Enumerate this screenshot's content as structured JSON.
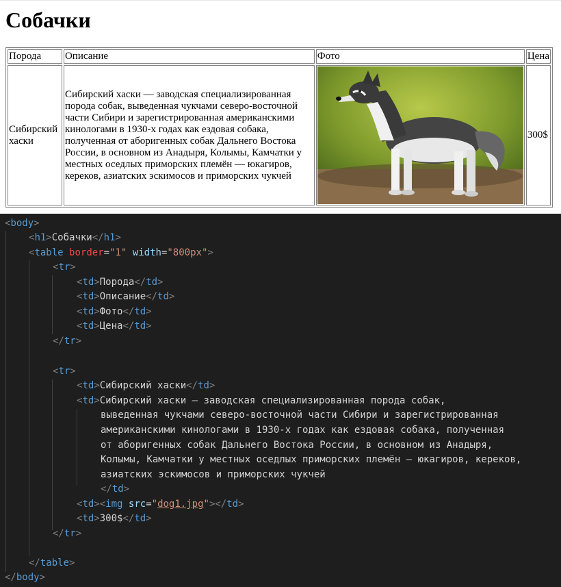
{
  "page": {
    "heading": "Собачки",
    "table": {
      "headers": [
        "Порода",
        "Описание",
        "Фото",
        "Цена"
      ],
      "row": {
        "breed": "Сибирский хаски",
        "description": "Сибирский хаски — заводская специализированная порода собак, выведенная чукчами северо-восточной части Сибири и зарегистрированная американскими кинологами в 1930-х годах как ездовая собака, полученная от аборигенных собак Дальнего Востока России, в основном из Анадыря, Колымы, Камчатки у местных оседлых приморских племён — юкагиров, кереков, азиатских эскимосов и приморских чукчей",
        "photo_icon": "siberian-husky-photo",
        "price": "300$"
      }
    }
  },
  "code": {
    "body_open": "body",
    "h1_tag": "h1",
    "h1_text": "Собачки",
    "table_tag": "table",
    "attr_border": "border",
    "attr_border_val": "\"1\"",
    "attr_width": "width",
    "attr_width_val": "\"800px\"",
    "tr": "tr",
    "td": "td",
    "cells_row1": [
      "Порода",
      "Описание",
      "Фото",
      "Цена"
    ],
    "cell_breed": "Сибирский хаски",
    "desc_lines": [
      "Сибирский хаски — заводская специализированная порода собак,",
      "выведенная чукчами северо-восточной части Сибири и зарегистрированная",
      "американскими кинологами в 1930-х годах как ездовая собака, полученная",
      "от аборигенных собак Дальнего Востока России, в основном из Анадыря,",
      "Колымы, Камчатки у местных оседлых приморских племён — юкагиров, кереков,",
      "азиатских эскимосов и приморских чукчей"
    ],
    "img_tag": "img",
    "attr_src": "src",
    "src_val": "dog1.jpg",
    "price": "300$"
  },
  "colors": {
    "editor_bg": "#1e1e1e",
    "tag": "#569cd6",
    "attr_name": "#9cdcfe",
    "attr_border": "#f44747",
    "string": "#ce9178"
  }
}
